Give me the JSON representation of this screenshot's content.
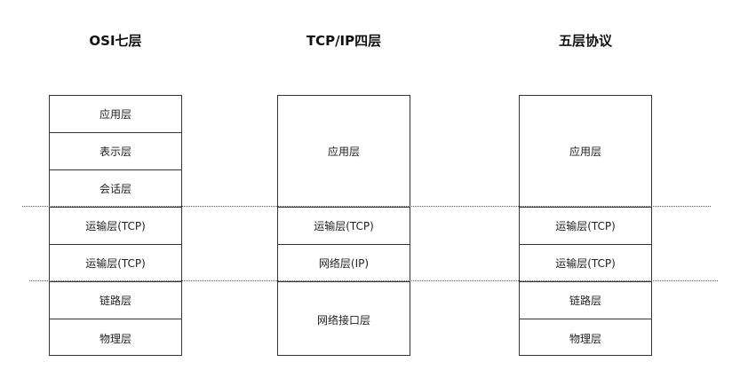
{
  "columns": [
    {
      "title": "OSI七层",
      "layers": [
        "应用层",
        "表示层",
        "会话层",
        "运输层(TCP)",
        "运输层(TCP)",
        "链路层",
        "物理层"
      ]
    },
    {
      "title": "TCP/IP四层",
      "layers": [
        "应用层",
        "运输层(TCP)",
        "网络层(IP)",
        "网络接口层"
      ]
    },
    {
      "title": "五层协议",
      "layers": [
        "应用层",
        "运输层(TCP)",
        "运输层(TCP)",
        "链路层",
        "物理层"
      ]
    }
  ]
}
